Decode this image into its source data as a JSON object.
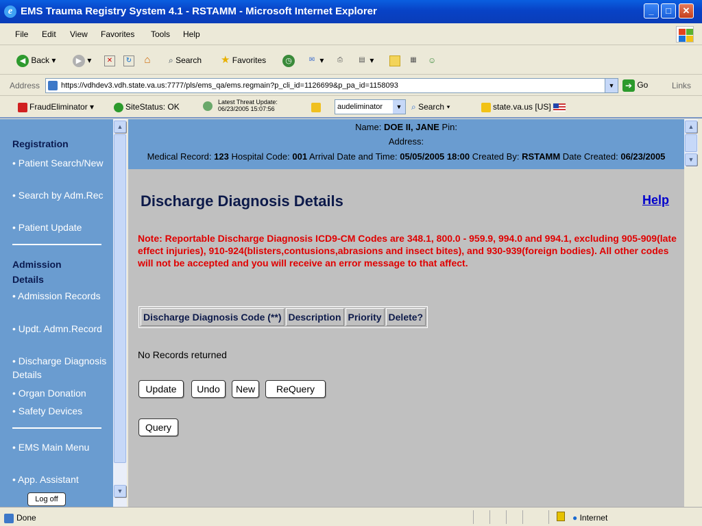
{
  "window": {
    "title": "EMS Trauma Registry System 4.1 - RSTAMM - Microsoft Internet Explorer"
  },
  "menu": [
    "File",
    "Edit",
    "View",
    "Favorites",
    "Tools",
    "Help"
  ],
  "toolbar": {
    "back": "Back",
    "search": "Search",
    "favorites": "Favorites"
  },
  "address": {
    "label": "Address",
    "url": "https://vdhdev3.vdh.state.va.us:7777/pls/ems_qa/ems.regmain?p_cli_id=1126699&p_pa_id=1158093",
    "go": "Go",
    "links": "Links"
  },
  "linksbar": {
    "fraud": "FraudEliminator",
    "sitestatus": "SiteStatus: OK",
    "threat_title": "Latest Threat Update:",
    "threat_date": "06/23/2005 15:07:56",
    "combo": "audeliminator",
    "search": "Search",
    "state": "state.va.us [US]"
  },
  "sidebar": {
    "registration_heading": "Registration",
    "registration_items": [
      "Patient Search/New",
      "Search by Adm.Rec",
      "Patient Update"
    ],
    "admission_heading": "Admission Details",
    "admission_items": [
      "Admission Records",
      "Updt. Admn.Record",
      "Discharge Diagnosis Details",
      "Organ Donation",
      "Safety Devices"
    ],
    "other_items": [
      "EMS Main Menu",
      "App. Assistant"
    ],
    "logoff": "Log off"
  },
  "header": {
    "name_label": "Name:",
    "name_value": "DOE II, JANE",
    "pin_label": "Pin:",
    "address_label": "Address:",
    "mr_label": "Medical Record:",
    "mr_value": "123",
    "hosp_label": "Hospital Code:",
    "hosp_value": "001",
    "arrival_label": "Arrival Date and Time:",
    "arrival_value": "05/05/2005 18:00",
    "created_by_label": "Created By:",
    "created_by_value": "RSTAMM",
    "date_created_label": "Date Created:",
    "date_created_value": "06/23/2005"
  },
  "main": {
    "title": "Discharge Diagnosis Details",
    "help": "Help",
    "note": "Note: Reportable Discharge Diagnosis ICD9-CM Codes are 348.1, 800.0 - 959.9, 994.0 and 994.1, excluding 905-909(late effect injuries), 910-924(blisters,contusions,abrasions and insect bites), and 930-939(foreign bodies). All other codes will not be accepted and you will receive an error message to that affect.",
    "columns": [
      "Discharge Diagnosis Code (**)",
      "Description",
      "Priority",
      "Delete?"
    ],
    "no_records": "No Records returned",
    "buttons": {
      "update": "Update",
      "undo": "Undo",
      "new": "New",
      "requery": "ReQuery",
      "query": "Query"
    }
  },
  "status": {
    "done": "Done",
    "zone": "Internet"
  }
}
